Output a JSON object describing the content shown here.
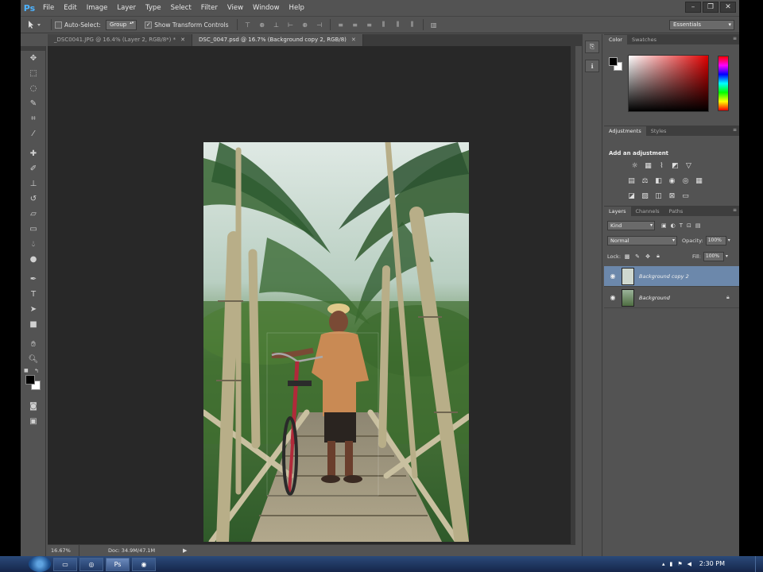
{
  "app": {
    "logo": "Ps",
    "accent": "#4eb3ff"
  },
  "menu": [
    "File",
    "Edit",
    "Image",
    "Layer",
    "Type",
    "Select",
    "Filter",
    "View",
    "Window",
    "Help"
  ],
  "window_controls": {
    "minimize": "–",
    "restore": "❐",
    "close": "✕"
  },
  "options_bar": {
    "tool_icon": "move-tool-icon",
    "auto_select_label": "Auto-Select:",
    "auto_select_checked": false,
    "auto_select_target": "Group",
    "show_transform_label": "Show Transform Controls",
    "show_transform_checked": true,
    "workspace": "Essentials"
  },
  "tabs": [
    {
      "title": "_DSC0041.JPG @ 16.4% (Layer 2, RGB/8*) *",
      "active": false
    },
    {
      "title": "DSC_0047.psd @ 16.7% (Background copy 2, RGB/8)",
      "active": true
    }
  ],
  "tools": [
    "move-tool",
    "marquee-tool",
    "lasso-tool",
    "quick-selection-tool",
    "crop-tool",
    "eyedropper-tool",
    "healing-brush-tool",
    "brush-tool",
    "clone-stamp-tool",
    "history-brush-tool",
    "eraser-tool",
    "gradient-tool",
    "blur-tool",
    "dodge-tool",
    "pen-tool",
    "type-tool",
    "path-selection-tool",
    "rectangle-tool",
    "hand-tool",
    "zoom-tool"
  ],
  "colors": {
    "foreground": "#000000",
    "background": "#ffffff",
    "selection_blue": "#6c88ab"
  },
  "status": {
    "zoom": "16.67%",
    "doc": "Doc: 34.9M/47.1M"
  },
  "color_panel": {
    "tabs": [
      "Color",
      "Swatches"
    ],
    "active": "Color"
  },
  "adjustments_panel": {
    "tabs": [
      "Adjustments",
      "Styles"
    ],
    "active": "Adjustments",
    "heading": "Add an adjustment"
  },
  "layers_panel": {
    "tabs": [
      "Layers",
      "Channels",
      "Paths"
    ],
    "active": "Layers",
    "filter": "Kind",
    "blend_mode": "Normal",
    "opacity_label": "Opacity:",
    "opacity": "100%",
    "lock_label": "Lock:",
    "fill_label": "Fill:",
    "fill": "100%",
    "layers": [
      {
        "name": "Background copy 2",
        "selected": true,
        "locked": false,
        "visible": true
      },
      {
        "name": "Background",
        "selected": false,
        "locked": true,
        "visible": true
      }
    ]
  },
  "taskbar": {
    "time": "2:30 PM"
  }
}
